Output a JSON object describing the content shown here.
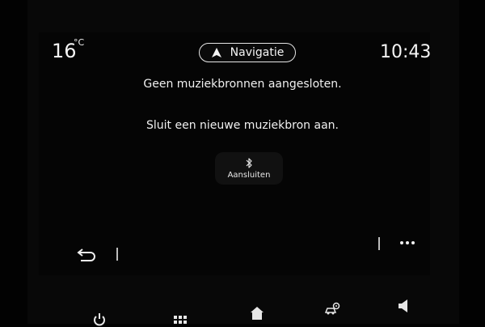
{
  "status_bar": {
    "temperature": "16",
    "temperature_unit": "°C",
    "time": "10:43"
  },
  "navigation_pill": {
    "label": "Navigatie",
    "icon": "navigation-arrow-icon"
  },
  "messages": {
    "no_sources": "Geen muziekbronnen aangesloten.",
    "connect_prompt": "Sluit een nieuwe muziekbron aan."
  },
  "connect_button": {
    "label": "Aansluiten",
    "icon": "bluetooth-icon"
  },
  "toolbar": {
    "back_icon": "back-icon",
    "more_icon": "more-icon"
  },
  "bottom_bar": {
    "icons": [
      "power-icon",
      "apps-grid-icon",
      "home-icon",
      "car-settings-icon",
      "volume-icon"
    ]
  },
  "colors": {
    "background": "#020202",
    "text": "#f2f2f2",
    "button_bg": "#111111"
  }
}
